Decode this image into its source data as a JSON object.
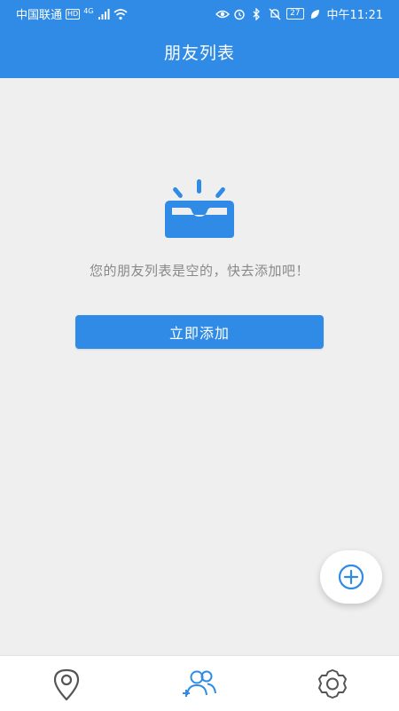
{
  "status_bar": {
    "carrier": "中国联通",
    "hd": "HD",
    "network": "4G",
    "battery": "27",
    "time": "中午11:21"
  },
  "header": {
    "title": "朋友列表"
  },
  "empty_state": {
    "message": "您的朋友列表是空的，快去添加吧！",
    "add_button_label": "立即添加"
  },
  "colors": {
    "primary": "#2f8be6",
    "background": "#f0eff0",
    "muted_text": "#888888",
    "icon_gray": "#555555"
  },
  "icons": {
    "empty_state": "inbox-tray-icon",
    "fab": "plus-circle-icon",
    "nav": [
      "location-pin-icon",
      "add-friends-icon",
      "settings-gear-icon"
    ]
  },
  "bottom_nav": {
    "active_index": 1
  }
}
